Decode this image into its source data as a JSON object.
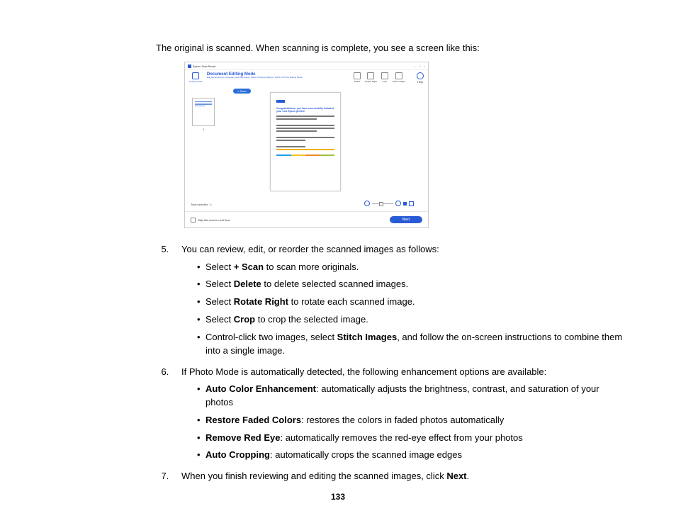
{
  "intro": "The original is scanned. When scanning is complete, you see a screen like this:",
  "screenshot": {
    "app_title": "Epson ScanSmart",
    "change_mode": "Change Mode",
    "header_title": "Document Editing Mode",
    "header_sub": "Edit documents as necessary and click [Next]. Select [Change Mode] to switch to Photo Editing Mode.",
    "scan_btn": "+ Scan",
    "tools": {
      "delete": "Delete",
      "rotate": "Rotate Right",
      "crop": "Crop",
      "stitch": "Stitch Images"
    },
    "help": "Help",
    "thumb_num": "1",
    "preview_title": "Congratulations, you have successfully installed your new Epson printer!",
    "status": "Total selected : 1",
    "skip": "Skip this screen next time.",
    "next": "Next"
  },
  "steps": {
    "s5_intro": "You can review, edit, or reorder the scanned images as follows:",
    "s5": {
      "b1_pre": "Select ",
      "b1_bold": "+ Scan",
      "b1_post": " to scan more originals.",
      "b2_pre": "Select ",
      "b2_bold": "Delete",
      "b2_post": " to delete selected scanned images.",
      "b3_pre": "Select ",
      "b3_bold": "Rotate Right",
      "b3_post": " to rotate each scanned image.",
      "b4_pre": "Select ",
      "b4_bold": "Crop",
      "b4_post": " to crop the selected image.",
      "b5_pre": "Control-click two images, select ",
      "b5_bold": "Stitch Images",
      "b5_post": ", and follow the on-screen instructions to combine them into a single image."
    },
    "s6_intro": "If Photo Mode is automatically detected, the following enhancement options are available:",
    "s6": {
      "b1_bold": "Auto Color Enhancement",
      "b1_post": ": automatically adjusts the brightness, contrast, and saturation of your photos",
      "b2_bold": "Restore Faded Colors",
      "b2_post": ": restores the colors in faded photos automatically",
      "b3_bold": "Remove Red Eye",
      "b3_post": ": automatically removes the red-eye effect from your photos",
      "b4_bold": "Auto Cropping",
      "b4_post": ": automatically crops the scanned image edges"
    },
    "s7_pre": "When you finish reviewing and editing the scanned images, click ",
    "s7_bold": "Next",
    "s7_post": "."
  },
  "page_number": "133"
}
